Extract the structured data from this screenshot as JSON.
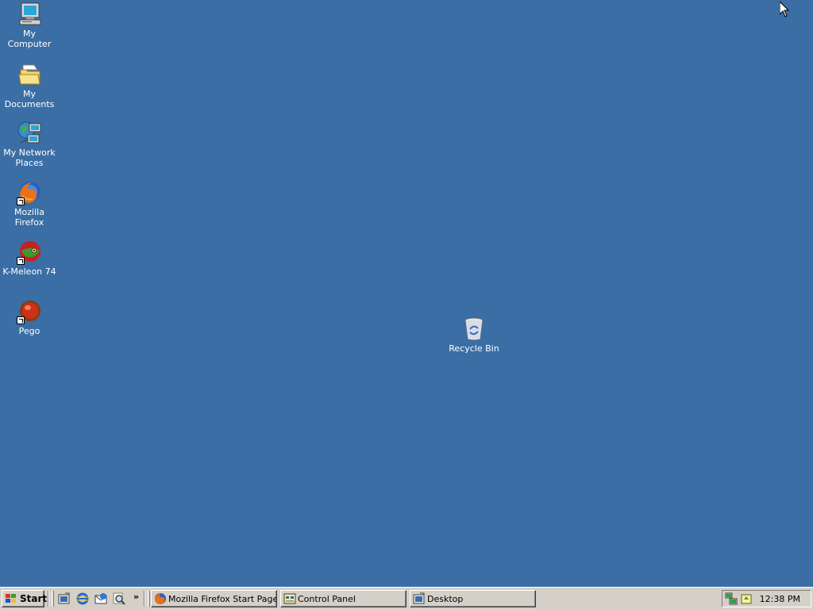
{
  "desktop": {
    "background_color": "#3a6ea5",
    "icons": [
      {
        "label": "My Computer",
        "icon": "computer-icon"
      },
      {
        "label": "My Documents",
        "icon": "folder-documents-icon"
      },
      {
        "label": "My Network Places",
        "icon": "network-places-icon"
      },
      {
        "label": "Mozilla Firefox",
        "icon": "firefox-icon",
        "shortcut": true
      },
      {
        "label": "K-Meleon 74",
        "icon": "kmeleon-icon",
        "shortcut": true
      },
      {
        "label": "Pego",
        "icon": "pego-icon",
        "shortcut": true
      },
      {
        "label": "Recycle Bin",
        "icon": "recycle-bin-icon"
      }
    ]
  },
  "taskbar": {
    "start_label": "Start",
    "quick_launch": [
      "show-desktop-icon",
      "internet-explorer-icon",
      "outlook-express-icon",
      "search-icon"
    ],
    "overflow": "»",
    "tasks": [
      {
        "label": "Mozilla Firefox Start Page...",
        "icon": "firefox-icon"
      },
      {
        "label": "Control Panel",
        "icon": "control-panel-icon"
      },
      {
        "label": "Desktop",
        "icon": "desktop-folder-icon"
      }
    ],
    "tray_icons": [
      "network-connection-icon",
      "update-icon"
    ],
    "clock": "12:38 PM"
  }
}
